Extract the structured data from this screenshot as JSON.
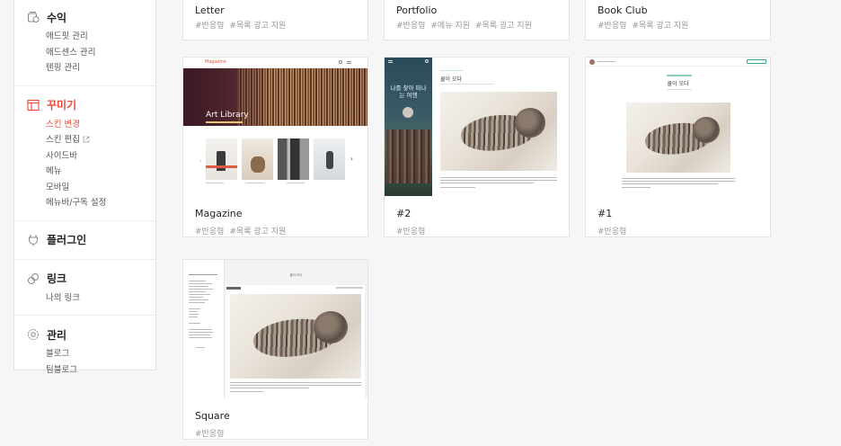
{
  "sidebar": {
    "groups": [
      {
        "title": "수익",
        "icon": "revenue-icon",
        "items": [
          "애드핏 관리",
          "애드센스 관리",
          "텐핑 관리"
        ]
      },
      {
        "title": "꾸미기",
        "icon": "layout-icon",
        "active": true,
        "items": [
          "스킨 변경",
          "스킨 편집",
          "사이드바",
          "메뉴",
          "모바일",
          "메뉴바/구독 설정"
        ]
      },
      {
        "title": "플러그인",
        "icon": "plug-icon",
        "items": []
      },
      {
        "title": "링크",
        "icon": "link-icon",
        "items": [
          "나의 링크"
        ]
      },
      {
        "title": "관리",
        "icon": "settings-icon",
        "items": [
          "블로그",
          "팀블로그"
        ]
      }
    ]
  },
  "accent_color": "#ec4a36",
  "top_cards": [
    {
      "name": "Letter",
      "tags": [
        "#반응형",
        "#목록 광고 지원"
      ]
    },
    {
      "name": "Portfolio",
      "tags": [
        "#반응형",
        "#메뉴 지원",
        "#목록 광고 지원"
      ]
    },
    {
      "name": "Book Club",
      "tags": [
        "#반응형",
        "#목록 광고 지원"
      ]
    }
  ],
  "cards": [
    {
      "name": "Magazine",
      "tags": [
        "#반응형",
        "#목록 광고 지원"
      ],
      "thumb_brand": "Magazine",
      "thumb_banner": "Art Library"
    },
    {
      "name": "#2",
      "tags": [
        "#반응형"
      ],
      "thumb_side_text": "나를 찾아 떠나는 여행",
      "thumb_post_title": "쿨이 오다"
    },
    {
      "name": "#1",
      "tags": [
        "#반응형"
      ],
      "thumb_post_title": "쿨이 오다"
    },
    {
      "name": "Square",
      "tags": [
        "#반응형"
      ],
      "thumb_top": "쿨이 오다"
    }
  ]
}
